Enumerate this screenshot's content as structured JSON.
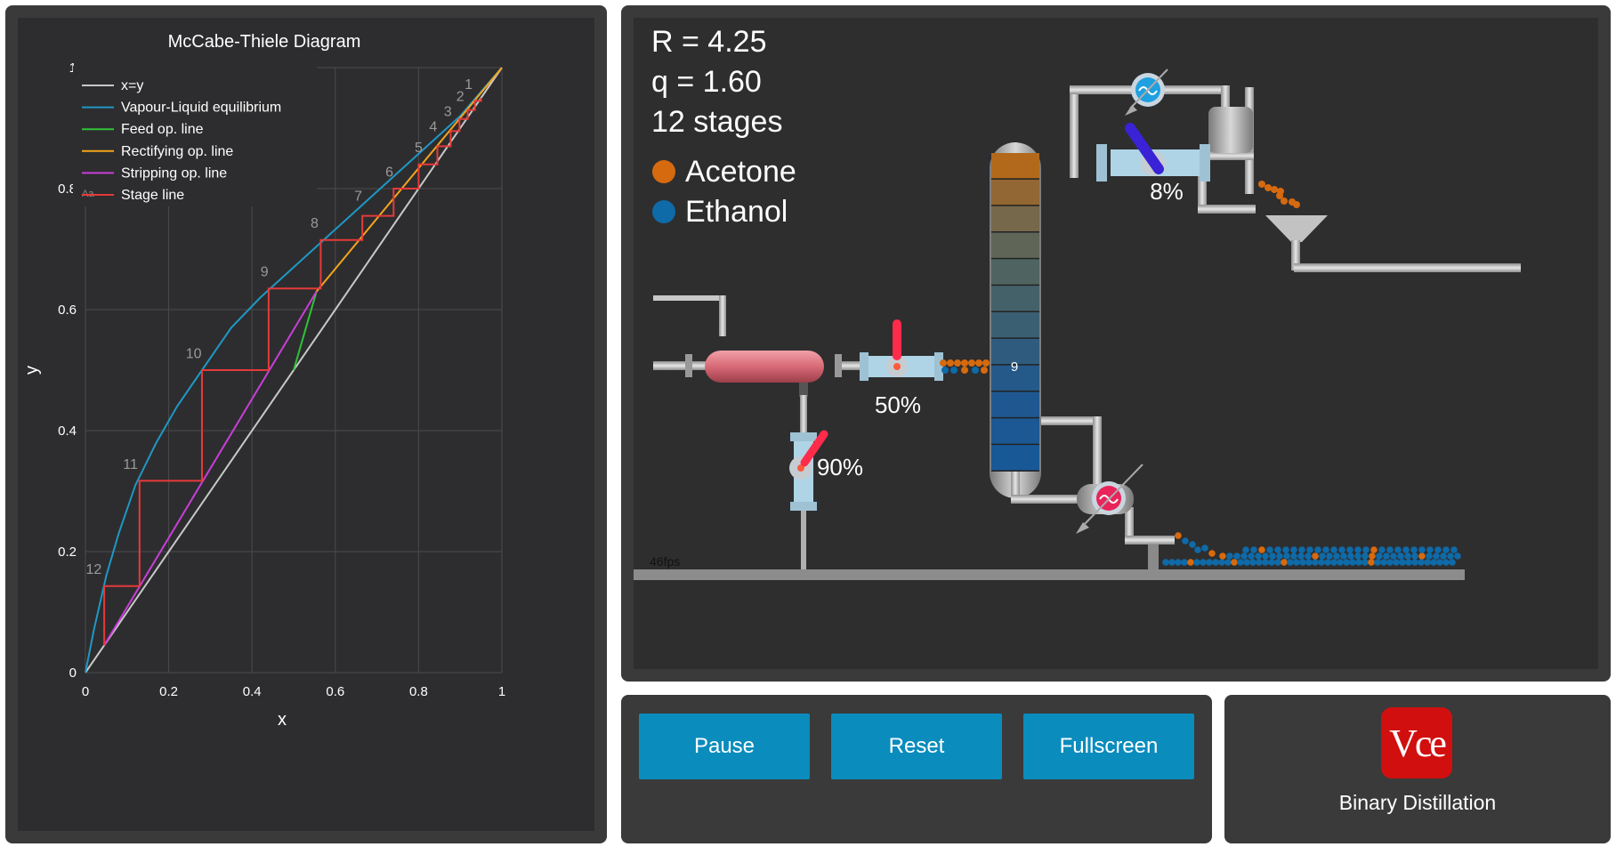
{
  "chart": {
    "title": "McCabe-Thiele Diagram",
    "xlabel": "x",
    "ylabel": "y",
    "x_ticks": [
      "0",
      "0.2",
      "0.4",
      "0.6",
      "0.8",
      "1"
    ],
    "y_ticks": [
      "0",
      "0.2",
      "0.4",
      "0.6",
      "0.8",
      "1"
    ],
    "legend_toggle": "Aa",
    "legend": [
      {
        "name": "x=y",
        "color": "#c8c8c8"
      },
      {
        "name": "Vapour-Liquid equilibrium",
        "color": "#1f98c4"
      },
      {
        "name": "Feed op. line",
        "color": "#2fc23a"
      },
      {
        "name": "Rectifying op. line",
        "color": "#f5a51c"
      },
      {
        "name": "Stripping op. line",
        "color": "#c93fd8"
      },
      {
        "name": "Stage line",
        "color": "#e63a3a"
      }
    ]
  },
  "chart_data": {
    "type": "line",
    "title": "McCabe-Thiele Diagram",
    "xlabel": "x",
    "ylabel": "y",
    "xlim": [
      0,
      1
    ],
    "ylim": [
      0,
      1
    ],
    "grid": true,
    "legend_position": "top-left",
    "series": [
      {
        "name": "x=y",
        "color": "#c8c8c8",
        "x": [
          0,
          1
        ],
        "y": [
          0,
          1
        ]
      },
      {
        "name": "Vapour-Liquid equilibrium",
        "color": "#1f98c4",
        "x": [
          0,
          0.02,
          0.05,
          0.08,
          0.12,
          0.17,
          0.22,
          0.28,
          0.35,
          0.42,
          0.5,
          0.58,
          0.66,
          0.74,
          0.82,
          0.9,
          0.95,
          1
        ],
        "y": [
          0,
          0.07,
          0.16,
          0.23,
          0.31,
          0.38,
          0.44,
          0.5,
          0.57,
          0.62,
          0.67,
          0.72,
          0.77,
          0.82,
          0.87,
          0.92,
          0.96,
          1
        ]
      },
      {
        "name": "Feed op. line",
        "color": "#2fc23a",
        "x": [
          0.5,
          0.555
        ],
        "y": [
          0.5,
          0.63
        ]
      },
      {
        "name": "Rectifying op. line",
        "color": "#f5a51c",
        "x": [
          0.555,
          1
        ],
        "y": [
          0.63,
          1
        ]
      },
      {
        "name": "Stripping op. line",
        "color": "#c93fd8",
        "x": [
          0.045,
          0.555
        ],
        "y": [
          0.045,
          0.63
        ]
      },
      {
        "name": "Stage line",
        "color": "#e63a3a",
        "x": [
          0.95,
          0.95,
          0.935,
          0.935,
          0.918,
          0.918,
          0.898,
          0.898,
          0.877,
          0.877,
          0.845,
          0.845,
          0.8,
          0.8,
          0.74,
          0.74,
          0.665,
          0.665,
          0.565,
          0.565,
          0.44,
          0.44,
          0.28,
          0.28,
          0.13,
          0.13,
          0.045,
          0.045
        ],
        "y": [
          0.95,
          0.945,
          0.945,
          0.93,
          0.93,
          0.915,
          0.915,
          0.895,
          0.895,
          0.87,
          0.87,
          0.84,
          0.84,
          0.8,
          0.8,
          0.755,
          0.755,
          0.715,
          0.715,
          0.635,
          0.635,
          0.5,
          0.5,
          0.317,
          0.317,
          0.143,
          0.143,
          0.045
        ]
      }
    ],
    "stage_labels": [
      {
        "label": "1",
        "x": 0.92,
        "y": 0.965
      },
      {
        "label": "2",
        "x": 0.9,
        "y": 0.945
      },
      {
        "label": "3",
        "x": 0.87,
        "y": 0.92
      },
      {
        "label": "4",
        "x": 0.835,
        "y": 0.895
      },
      {
        "label": "5",
        "x": 0.8,
        "y": 0.86
      },
      {
        "label": "6",
        "x": 0.73,
        "y": 0.82
      },
      {
        "label": "7",
        "x": 0.655,
        "y": 0.78
      },
      {
        "label": "8",
        "x": 0.55,
        "y": 0.735
      },
      {
        "label": "9",
        "x": 0.43,
        "y": 0.655
      },
      {
        "label": "10",
        "x": 0.26,
        "y": 0.52
      },
      {
        "label": "11",
        "x": 0.108,
        "y": 0.337
      },
      {
        "label": "12",
        "x": 0.02,
        "y": 0.163
      }
    ]
  },
  "simulation": {
    "reflux": "R = 4.25",
    "q_value": "q = 1.60",
    "stages": "12 stages",
    "components": [
      {
        "name": "Acetone",
        "color": "#d66a0f"
      },
      {
        "name": "Ethanol",
        "color": "#0f6aa8"
      }
    ],
    "feed_stage_label": "9",
    "feed_valve_pct": "50%",
    "bottom_valve_pct": "90%",
    "top_valve_pct": "8%",
    "fps": "46fps"
  },
  "controls": {
    "pause": "Pause",
    "reset": "Reset",
    "fullscreen": "Fullscreen"
  },
  "brand": {
    "logo_text": "Vce",
    "caption": "Binary Distillation"
  }
}
